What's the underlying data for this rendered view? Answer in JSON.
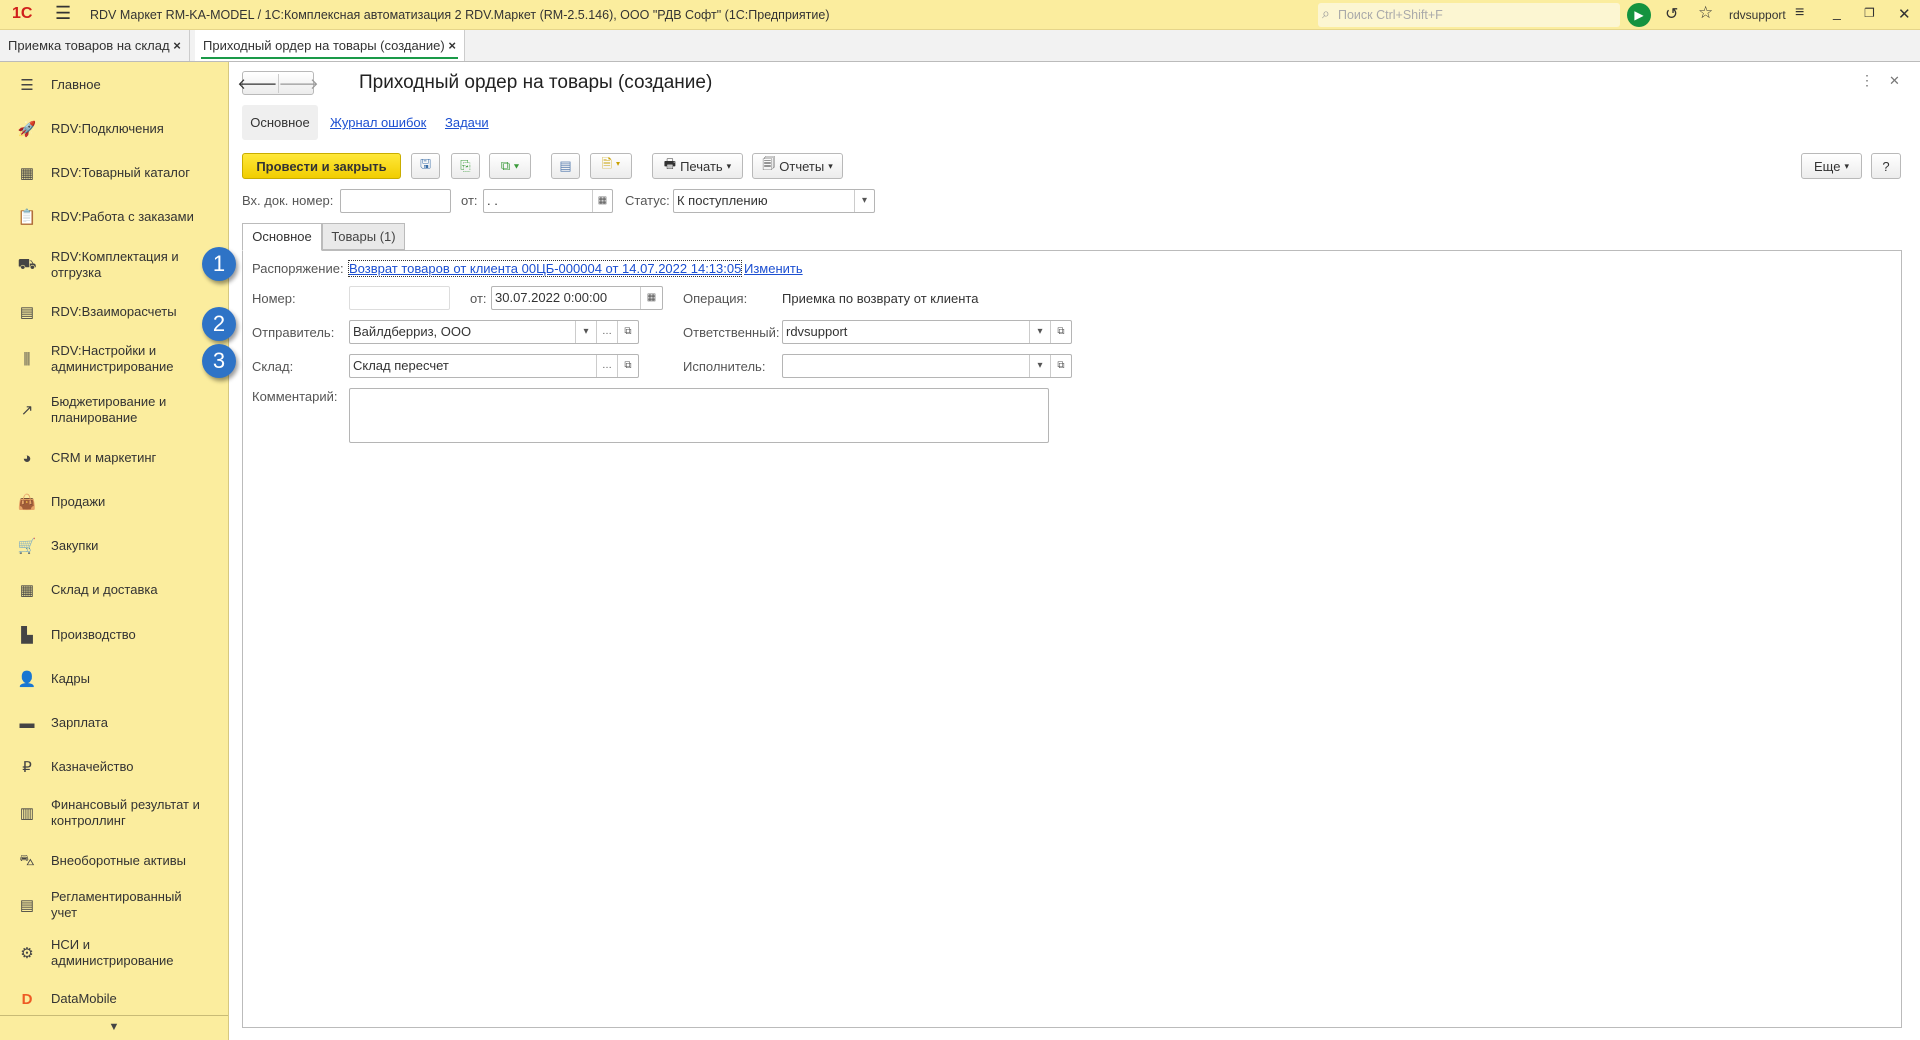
{
  "titlebar": {
    "logo": "1С",
    "title": "RDV Маркет RM-KA-MODEL / 1С:Комплексная автоматизация 2 RDV.Маркет (RM-2.5.146), ООО \"РДВ Софт\"  (1С:Предприятие)",
    "search_placeholder": "Поиск Ctrl+Shift+F",
    "user": "rdvsupport"
  },
  "window_tabs": [
    {
      "label": "Приемка товаров на склад",
      "close": "×"
    },
    {
      "label": "Приходный ордер на товары (создание)",
      "close": "×"
    }
  ],
  "sidebar": {
    "items": [
      {
        "label": "Главное",
        "icon": "☰"
      },
      {
        "label": "RDV:Подключения",
        "icon": "🚀"
      },
      {
        "label": "RDV:Товарный каталог",
        "icon": "▦"
      },
      {
        "label": "RDV:Работа с заказами",
        "icon": "📋"
      },
      {
        "label": "RDV:Комплектация и отгрузка",
        "icon": "⛟"
      },
      {
        "label": "RDV:Взаиморасчеты",
        "icon": "▤"
      },
      {
        "label": "RDV:Настройки и администрирование",
        "icon": "⫼"
      },
      {
        "label": "Бюджетирование и планирование",
        "icon": "↗"
      },
      {
        "label": "CRM и маркетинг",
        "icon": "◕"
      },
      {
        "label": "Продажи",
        "icon": "👜"
      },
      {
        "label": "Закупки",
        "icon": "🛒"
      },
      {
        "label": "Склад и доставка",
        "icon": "▦"
      },
      {
        "label": "Производство",
        "icon": "▙"
      },
      {
        "label": "Кадры",
        "icon": "👤"
      },
      {
        "label": "Зарплата",
        "icon": "▬"
      },
      {
        "label": "Казначейство",
        "icon": "₽"
      },
      {
        "label": "Финансовый результат и контроллинг",
        "icon": "▥"
      },
      {
        "label": "Внеоборотные активы",
        "icon": "⛍"
      },
      {
        "label": "Регламентированный учет",
        "icon": "▤"
      },
      {
        "label": "НСИ и администрирование",
        "icon": "⚙"
      },
      {
        "label": "DataMobile",
        "icon": "D"
      }
    ]
  },
  "form": {
    "title": "Приходный ордер на товары (создание)",
    "subtabs": [
      "Основное",
      "Журнал ошибок",
      "Задачи"
    ],
    "toolbar": {
      "post_close": "Провести и закрыть",
      "print": "Печать",
      "reports": "Отчеты",
      "more": "Еще",
      "help": "?"
    },
    "header": {
      "in_doc_label": "Вх. док. номер:",
      "in_doc_value": "",
      "from_label": "от:",
      "from_value": " .  .",
      "status_label": "Статус:",
      "status_value": "К поступлению"
    },
    "tabs": [
      "Основное",
      "Товары (1)"
    ],
    "fields": {
      "order_label": "Распоряжение:",
      "order_value": "Возврат товаров от клиента 00ЦБ-000004 от 14.07.2022 14:13:05",
      "change": "Изменить",
      "number_label": "Номер:",
      "number_value": "",
      "date_label": "от:",
      "date_value": "30.07.2022  0:00:00",
      "operation_label": "Операция:",
      "operation_value": "Приемка по возврату от клиента",
      "sender_label": "Отправитель:",
      "sender_value": "Вайлдберриз, ООО",
      "responsible_label": "Ответственный:",
      "responsible_value": "rdvsupport",
      "warehouse_label": "Склад:",
      "warehouse_value": "Склад пересчет",
      "executor_label": "Исполнитель:",
      "executor_value": "",
      "comment_label": "Комментарий:",
      "comment_value": ""
    }
  },
  "badges": [
    "1",
    "2",
    "3"
  ]
}
